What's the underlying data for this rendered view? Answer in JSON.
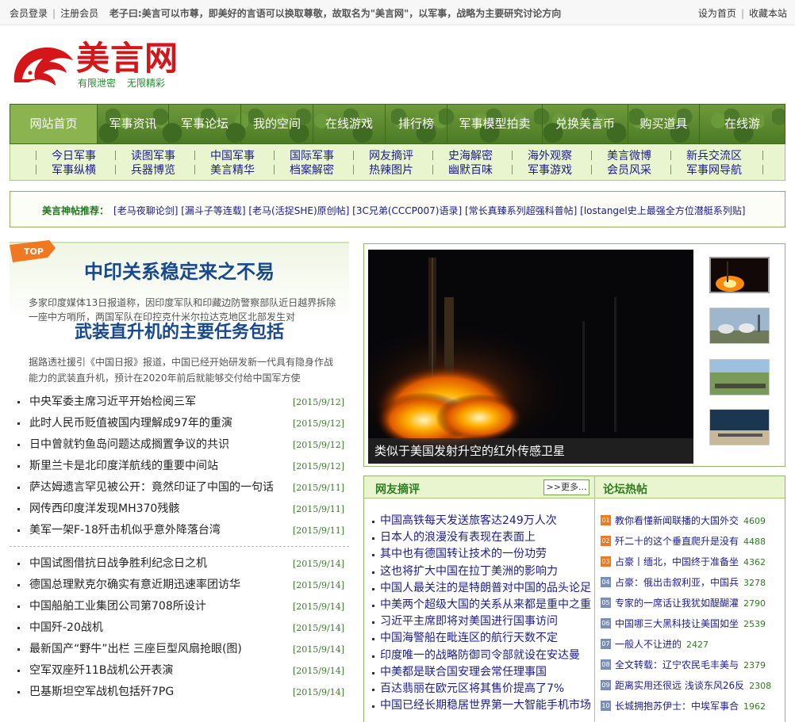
{
  "topbar": {
    "login": "会员登录",
    "register": "注册会员",
    "motto": "老子曰:美言可以市尊，即美好的言语可以换取尊敬，故取名为\"美言网\"，以军事，战略为主要研究讨论方向",
    "set_home": "设为首页",
    "bookmark": "收藏本站"
  },
  "logo": {
    "name": "美言网",
    "slogan_1": "有限泄密",
    "slogan_2": "无限精彩"
  },
  "nav": [
    "网站首页",
    "军事资讯",
    "军事论坛",
    "我的空间",
    "在线游戏",
    "排行榜",
    "军事模型拍卖",
    "兑换美言币",
    "购买道具",
    "在线游"
  ],
  "subnav": [
    [
      "今日军事",
      "军事纵横"
    ],
    [
      "读图军事",
      "兵器博览"
    ],
    [
      "中国军事",
      "美言精华"
    ],
    [
      "国际军事",
      "档案解密"
    ],
    [
      "网友摘评",
      "热辣图片"
    ],
    [
      "史海解密",
      "幽默百味"
    ],
    [
      "海外观察",
      "军事游戏"
    ],
    [
      "美言微博",
      "会员风采"
    ],
    [
      "新兵交流区",
      "军事网导航"
    ]
  ],
  "recommend": {
    "label": "美言神帖推荐：",
    "items": "[老马夜聊论剑] [漏斗子等连载] [老马(活捉SHE)原创帖] [3C兄弟(CCCP007)语录] [常长真臻系列超强科普帖] [lostangel史上最强全方位潜艇系列贴]"
  },
  "top_news": {
    "badge": "TOP",
    "headline_1": "中印关系稳定来之不易",
    "summary_1": "多家印度媒体13日报道称，因印度军队和印藏边防警察部队近日越界拆除一座中方哨所，两国军队在印控克什米尔拉达克地区北部发生对",
    "headline_2": "武装直升机的主要任务包括",
    "summary_2": "据路透社援引《中国日报》报道，中国已经开始研发新一代具有隐身作战能力的武装直升机，预计在2020年前后就能够交付给中国军方使"
  },
  "news_1": [
    {
      "title": "中央军委主席习近平开始检阅三军",
      "date": "[2015/9/12]"
    },
    {
      "title": "此时人民币贬值被国内理解成97年的重演",
      "date": "[2015/9/12]"
    },
    {
      "title": "日中曾就钓鱼岛问题达成搁置争议的共识",
      "date": "[2015/9/12]"
    },
    {
      "title": "斯里兰卡是北印度洋航线的重要中间站",
      "date": "[2015/9/12]"
    },
    {
      "title": "萨达姆遗言罕见被公开：竟然印证了中国的一句话",
      "date": "[2015/9/11]"
    },
    {
      "title": "网传西印度洋发现MH370残骸",
      "date": "[2015/9/11]"
    },
    {
      "title": "美军一架F-18歼击机似乎意外降落台湾",
      "date": "[2015/9/11]"
    }
  ],
  "news_2": [
    {
      "title": "中国试图借抗日战争胜利纪念日之机",
      "date": "[2015/9/14]"
    },
    {
      "title": "德国总理默克尔确实有意近期迅速率团访华",
      "date": "[2015/9/14]"
    },
    {
      "title": "中国船舶工业集团公司第708所设计",
      "date": "[2015/9/14]"
    },
    {
      "title": "中国歼-20战机",
      "date": "[2015/9/14]"
    },
    {
      "title": "最新国产“野牛”出栏 三座巨型风扇抢眼(图)",
      "date": "[2015/9/14]"
    },
    {
      "title": "空军双座歼11B战机公开表演",
      "date": "[2015/9/14]"
    },
    {
      "title": "巴基斯坦空军战机包括歼7PG",
      "date": "[2015/9/14]"
    }
  ],
  "slideshow": {
    "caption": "类似于美国发射升空的红外传感卫星"
  },
  "comments_panel": {
    "title": "网友摘评",
    "more": ">>更多...",
    "items": [
      "中国高铁每天发送旅客达249万人次",
      "日本人的浪漫没有表现在表面上",
      "其中也有德国转让技术的一份功劳",
      "这也将扩大中国在拉丁美洲的影响力",
      "中国人最关注的是特朗普对中国的品头论足",
      "中美两个超级大国的关系从来都是重中之重",
      "习近平主席即将对美国进行国事访问",
      "中国海警船在毗连区的航行天数不定",
      "印度唯一的战略防御司令部就设在安达曼",
      "中美都是联合国安理会常任理事国",
      "百达翡丽在欧元区将其售价提高了7%",
      "中国已经长期稳居世界第一大智能手机市场"
    ]
  },
  "forum_panel": {
    "title": "论坛热帖",
    "items": [
      {
        "num": "01",
        "title": "教你看懂新闻联播的大国外交",
        "count": "4609"
      },
      {
        "num": "02",
        "title": "歼二十的这个垂直爬升是没有",
        "count": "4488"
      },
      {
        "num": "03",
        "title": "占豪丨缅北，中国终于准备坐",
        "count": "4362"
      },
      {
        "num": "04",
        "title": "占豪：俄出击叙利亚，中国兵",
        "count": "3278"
      },
      {
        "num": "05",
        "title": "专家的一席话让我犹如醍醐灌",
        "count": "2790"
      },
      {
        "num": "06",
        "title": "中国哪三大黑科技让美国如坐",
        "count": "2539"
      },
      {
        "num": "07",
        "title": "一般人不让进的",
        "count": "2427"
      },
      {
        "num": "08",
        "title": "全文转载：辽宁农民毛丰美与",
        "count": "2379"
      },
      {
        "num": "09",
        "title": "距离实用还很远 浅谈东风26反",
        "count": "2308"
      },
      {
        "num": "10",
        "title": "长城拥抱苏伊士：中埃军事合",
        "count": "1962"
      }
    ]
  },
  "colors": {
    "nav_green": "#5a8a2e",
    "subnav_bg": "#e9f5cf",
    "headline_blue": "#17498c",
    "logo_red": "#d4151a"
  }
}
